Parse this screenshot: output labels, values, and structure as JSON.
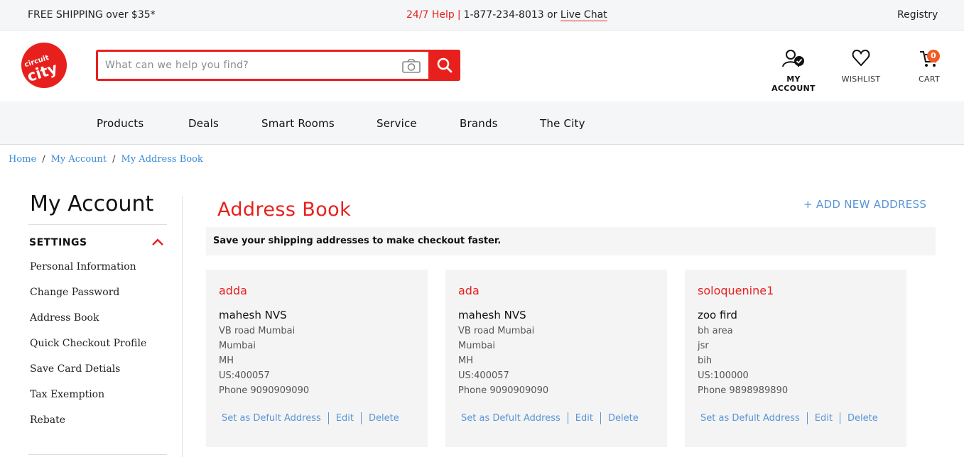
{
  "topbar": {
    "shipping": "FREE SHIPPING over $35*",
    "help_label": "24/7 Help",
    "help_sep": "|",
    "phone": "1-877-234-8013 or",
    "live_chat": "Live Chat",
    "registry": "Registry"
  },
  "header": {
    "search_placeholder": "What can we help you find?",
    "account_label": "MY ACCOUNT",
    "wishlist_label": "WISHLIST",
    "cart_label": "CART",
    "cart_count": "0"
  },
  "nav": {
    "items": [
      "Products",
      "Deals",
      "Smart Rooms",
      "Service",
      "Brands",
      "The City"
    ]
  },
  "breadcrumb": {
    "items": [
      "Home",
      "My Account",
      "My Address Book"
    ],
    "sep": "/"
  },
  "sidebar": {
    "title": "My Account",
    "section": "SETTINGS",
    "items": [
      "Personal Information",
      "Change Password",
      "Address Book",
      "Quick Checkout Profile",
      "Save Card Detials",
      "Tax Exemption",
      "Rebate"
    ]
  },
  "main": {
    "title": "Address Book",
    "add_new": "+ ADD NEW ADDRESS",
    "notice": "Save your shipping addresses to make checkout faster.",
    "cards": [
      {
        "nickname": "adda",
        "name": "mahesh NVS",
        "lines": [
          "VB road Mumbai",
          "Mumbai",
          "MH",
          "US:400057",
          "Phone 9090909090"
        ],
        "set_default": "Set as Defult Address",
        "edit": "Edit",
        "delete": "Delete"
      },
      {
        "nickname": "ada",
        "name": "mahesh NVS",
        "lines": [
          "VB road Mumbai",
          "Mumbai",
          "MH",
          "US:400057",
          "Phone 9090909090"
        ],
        "set_default": "Set as Defult Address",
        "edit": "Edit",
        "delete": "Delete"
      },
      {
        "nickname": "soloquenine1",
        "name": "zoo fird",
        "lines": [
          "bh area",
          "jsr",
          "bih",
          "US:100000",
          "Phone 9898989890"
        ],
        "set_default": "Set as Defult Address",
        "edit": "Edit",
        "delete": "Delete"
      }
    ]
  },
  "colors": {
    "brand_red": "#e8201d",
    "link_blue": "#5a95d6",
    "badge_orange": "#f15a22"
  }
}
